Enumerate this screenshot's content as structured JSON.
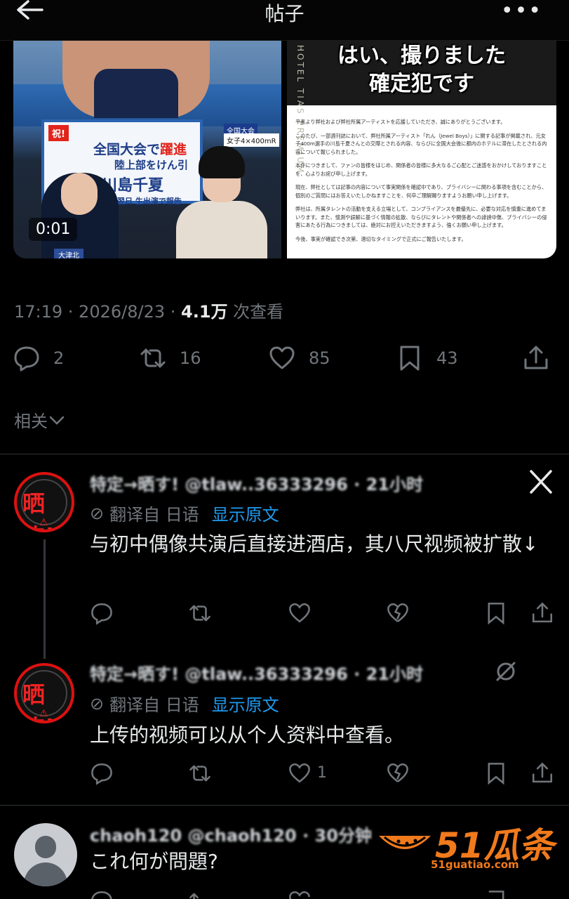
{
  "header": {
    "title": "帖子"
  },
  "media": {
    "video_time": "0:01",
    "panel": {
      "tag": "祝!",
      "line1_a": "全国大会で",
      "line1_b": "躍進",
      "line2": "陸上部をけん引",
      "line3": "川島千夏",
      "line4": "大会翌日 生出演で報告"
    },
    "side_tag": "全国大会",
    "side_tag2": "女子4×400mR",
    "sign": "大津北",
    "right_caption_1": "はい、撮りました",
    "right_caption_2": "確定犯です",
    "hotel_text": "HOTEL TIAS PREMIUM",
    "doc_paragraphs": [
      "平素より弊社および弊社所属アーティストを応援していただき、誠にありがとうございます。",
      "このたび、一部週刊誌において、弊社所属アーティスト「れん（Jewel Boys）」に関する記事が掲載され、元女子400m選手の川島千夏さんとの交際とされる内容、ならびに全国大会後に都内のホテルに滞在したとされる内容について報じられました。",
      "本件につきまして、ファンの皆様をはじめ、関係者の皆様に多大なるご心配とご迷惑をおかけしておりますことを、心よりお詫び申し上げます。",
      "現在、弊社としては記事の内容について事実関係を確認中であり、プライバシーに関わる事項を含むことから、個別のご質問にはお答えいたしかねますことを、何卒ご理解賜りますようお願い申し上げます。",
      "弊社は、所属タレントの活動を支える立場として、コンプライアンスを最優先に、必要な対応を慎重に進めてまいります。また、憶測や誤解に基づく情報の拡散、ならびにタレントや関係者への誹謗中傷、プライバシーの侵害にあたる行為につきましては、絶対にお控えいただきますよう、強くお願い申し上げます。",
      "今後、事実が確認でき次第、適切なタイミングで正式にご報告いたします。"
    ]
  },
  "meta": {
    "time": "17:19 · 2026/8/23 · ",
    "views": "4.1万",
    "views_suffix": " 次查看"
  },
  "stats": {
    "replies": "2",
    "retweets": "16",
    "likes": "85",
    "bookmarks": "43"
  },
  "related_label": "相关",
  "tweets": [
    {
      "avatar_text": "晒す!",
      "name_line": "特定→晒す!  @tlaw..36333296 · 21小时",
      "translate_label": "翻译自 日语",
      "show_original": "显示原文",
      "text": "与初中偶像共演后直接进酒店，其八尺视频被扩散↓",
      "like_count": ""
    },
    {
      "avatar_text": "晒す!",
      "name_line": "特定→晒す!  @tlaw..36333296 · 21小时",
      "translate_label": "翻译自 日语",
      "show_original": "显示原文",
      "text": "上传的视频可以从个人资料中查看。",
      "like_count": "1"
    },
    {
      "name_line": "chaoh120  @chaoh120 · 30分钟",
      "text": "これ何が問題?"
    }
  ],
  "watermark": {
    "number": "51瓜条",
    "url": "51guatiao.com"
  }
}
